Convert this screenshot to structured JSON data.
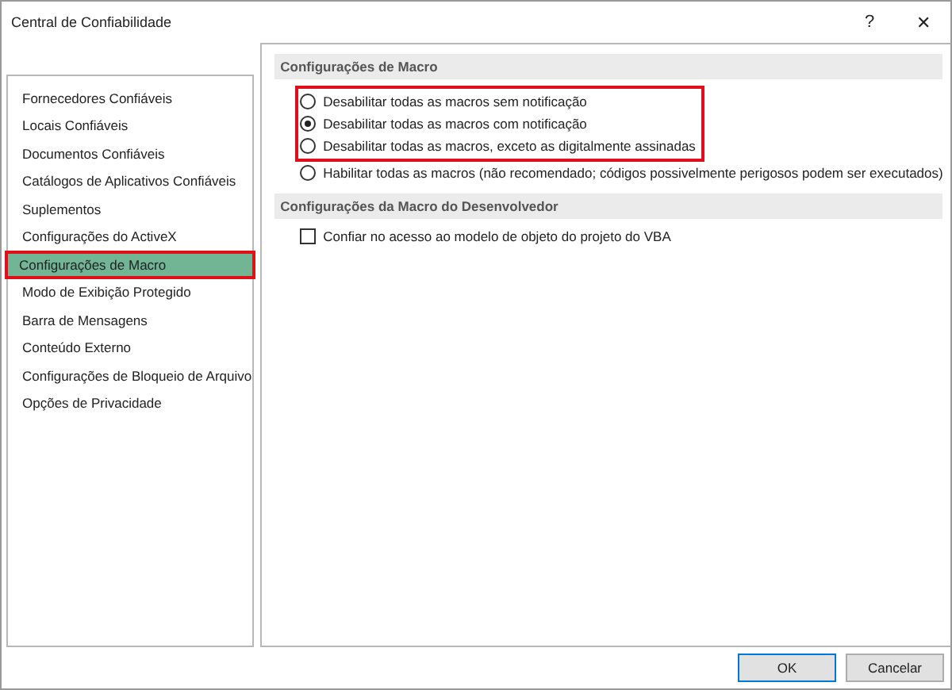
{
  "window": {
    "title": "Central de Confiabilidade",
    "help": "?",
    "close": "✕"
  },
  "sidebar": {
    "items": [
      {
        "label": "Fornecedores Confiáveis",
        "selected": false,
        "highlighted": false
      },
      {
        "label": "Locais Confiáveis",
        "selected": false,
        "highlighted": false
      },
      {
        "label": "Documentos Confiáveis",
        "selected": false,
        "highlighted": false
      },
      {
        "label": "Catálogos de Aplicativos Confiáveis",
        "selected": false,
        "highlighted": false
      },
      {
        "label": "Suplementos",
        "selected": false,
        "highlighted": false
      },
      {
        "label": "Configurações do ActiveX",
        "selected": false,
        "highlighted": false
      },
      {
        "label": "Configurações de Macro",
        "selected": true,
        "highlighted": true
      },
      {
        "label": "Modo de Exibição Protegido",
        "selected": false,
        "highlighted": false
      },
      {
        "label": "Barra de Mensagens",
        "selected": false,
        "highlighted": false
      },
      {
        "label": "Conteúdo Externo",
        "selected": false,
        "highlighted": false
      },
      {
        "label": "Configurações de Bloqueio de Arquivo",
        "selected": false,
        "highlighted": false
      },
      {
        "label": "Opções de Privacidade",
        "selected": false,
        "highlighted": false
      }
    ]
  },
  "sections": [
    {
      "title": "Configurações de Macro",
      "kind": "radio",
      "options": [
        {
          "label": "Desabilitar todas as macros sem notificação",
          "selected": false,
          "highlighted": true
        },
        {
          "label": "Desabilitar todas as macros com notificação",
          "selected": true,
          "highlighted": true
        },
        {
          "label": "Desabilitar todas as macros, exceto as digitalmente assinadas",
          "selected": false,
          "highlighted": true
        },
        {
          "label": "Habilitar todas as macros (não recomendado; códigos possivelmente perigosos podem ser executados)",
          "selected": false,
          "highlighted": false
        }
      ]
    },
    {
      "title": "Configurações da Macro do Desenvolvedor",
      "kind": "checkbox",
      "options": [
        {
          "label": "Confiar no acesso ao modelo de objeto do projeto do VBA",
          "checked": false
        }
      ]
    }
  ],
  "buttons": [
    {
      "label": "OK",
      "default": true
    },
    {
      "label": "Cancelar",
      "default": false
    }
  ]
}
